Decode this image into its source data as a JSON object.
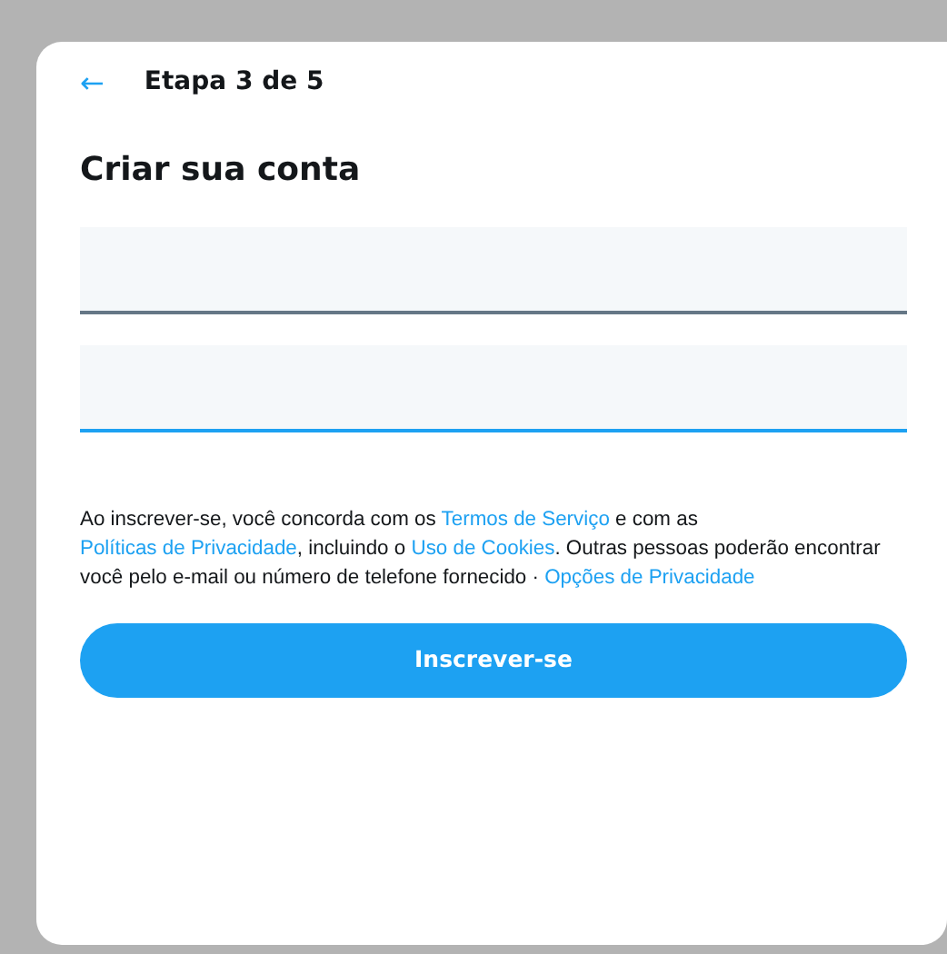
{
  "header": {
    "back_icon": "←",
    "step": "Etapa 3 de 5"
  },
  "title": "Criar sua conta",
  "fields": [
    {
      "focused": false
    },
    {
      "focused": true
    }
  ],
  "legal": [
    {
      "kind": "text",
      "text": "Ao inscrever-se, você concorda com os "
    },
    {
      "kind": "link",
      "text": "Termos de Serviço"
    },
    {
      "kind": "text",
      "text": " e com as "
    },
    {
      "kind": "link",
      "text": "Políticas de Privacidade"
    },
    {
      "kind": "text",
      "text": ", incluindo o "
    },
    {
      "kind": "link",
      "text": "Uso de Cookies"
    },
    {
      "kind": "text",
      "text": ". Outras pessoas poderão encontrar você pelo e-mail ou número de telefone fornecido · "
    },
    {
      "kind": "link",
      "text": "Opções de Privacidade"
    }
  ],
  "submit": "Inscrever-se"
}
